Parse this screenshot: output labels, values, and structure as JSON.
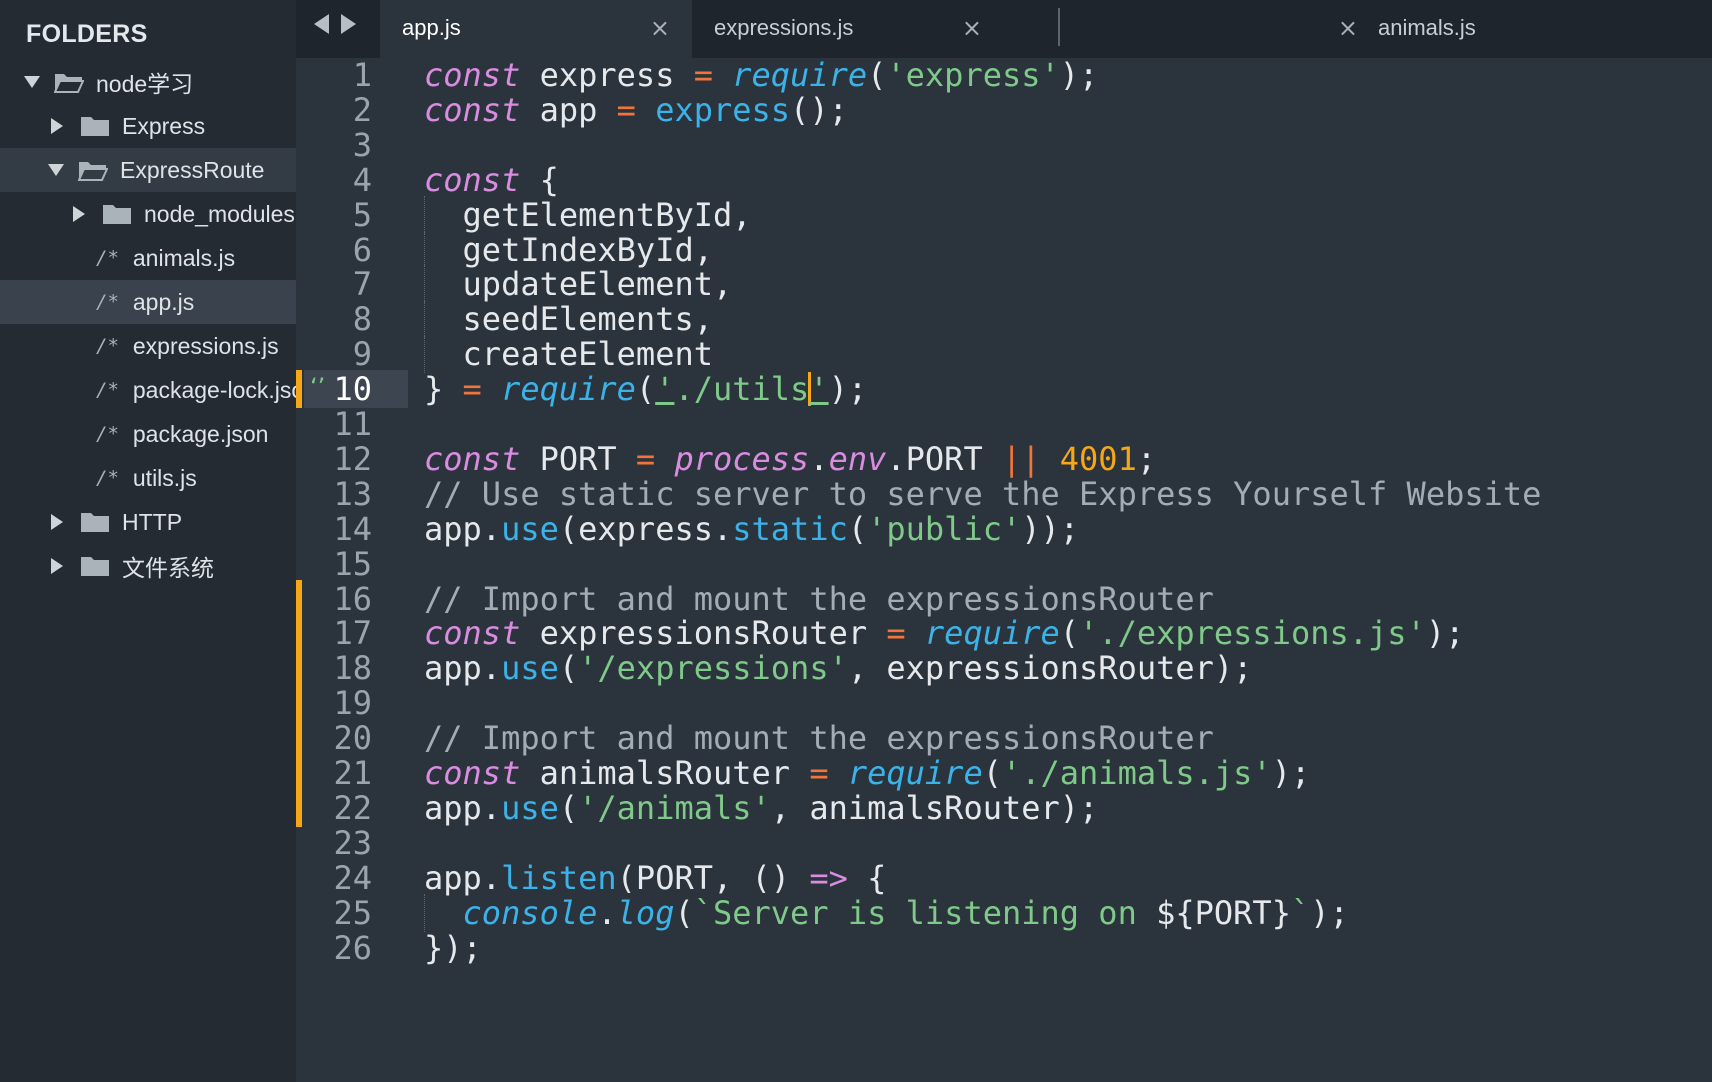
{
  "sidebar": {
    "title": "FOLDERS",
    "tree": [
      {
        "label": "node学习",
        "kind": "folder",
        "expanded": true
      },
      {
        "label": "Express",
        "kind": "folder",
        "expanded": false
      },
      {
        "label": "ExpressRoute",
        "kind": "folder",
        "expanded": true
      },
      {
        "label": "node_modules",
        "kind": "folder",
        "expanded": false
      },
      {
        "label": "animals.js",
        "kind": "file",
        "glyph": "/*"
      },
      {
        "label": "app.js",
        "kind": "file",
        "glyph": "/*"
      },
      {
        "label": "expressions.js",
        "kind": "file",
        "glyph": "/*"
      },
      {
        "label": "package-lock.json",
        "kind": "file",
        "glyph": "/*"
      },
      {
        "label": "package.json",
        "kind": "file",
        "glyph": "/*"
      },
      {
        "label": "utils.js",
        "kind": "file",
        "glyph": "/*"
      },
      {
        "label": "HTTP",
        "kind": "folder",
        "expanded": false
      },
      {
        "label": "文件系统",
        "kind": "folder",
        "expanded": false
      }
    ]
  },
  "tabs": [
    {
      "label": "app.js",
      "active": true,
      "close": "×"
    },
    {
      "label": "expressions.js",
      "active": false,
      "close": "×"
    },
    {
      "label": "animals.js",
      "active": false,
      "close": "×"
    }
  ],
  "editor": {
    "current_line": 10,
    "lint_icon_glyph": "‘’",
    "line_numbers": [
      "1",
      "2",
      "3",
      "4",
      "5",
      "6",
      "7",
      "8",
      "9",
      "10",
      "11",
      "12",
      "13",
      "14",
      "15",
      "16",
      "17",
      "18",
      "19",
      "20",
      "21",
      "22",
      "23",
      "24",
      "25",
      "26"
    ],
    "lines": [
      [
        [
          "kw",
          "const"
        ],
        [
          "pn",
          " express "
        ],
        [
          "op",
          "="
        ],
        [
          "pn",
          " "
        ],
        [
          "fi",
          "require"
        ],
        [
          "pn",
          "("
        ],
        [
          "str",
          "'express'"
        ],
        [
          "pn",
          ");"
        ]
      ],
      [
        [
          "kw",
          "const"
        ],
        [
          "pn",
          " app "
        ],
        [
          "op",
          "="
        ],
        [
          "pn",
          " "
        ],
        [
          "fn",
          "express"
        ],
        [
          "pn",
          "();"
        ]
      ],
      [],
      [
        [
          "kw",
          "const"
        ],
        [
          "pn",
          " {"
        ]
      ],
      [
        [
          "pn",
          "  getElementById,"
        ]
      ],
      [
        [
          "pn",
          "  getIndexById,"
        ]
      ],
      [
        [
          "pn",
          "  updateElement,"
        ]
      ],
      [
        [
          "pn",
          "  seedElements,"
        ]
      ],
      [
        [
          "pn",
          "  createElement"
        ]
      ],
      [
        [
          "pn",
          "} "
        ],
        [
          "op",
          "="
        ],
        [
          "pn",
          " "
        ],
        [
          "fi",
          "require"
        ],
        [
          "pn",
          "("
        ],
        [
          "str",
          "'./utils'"
        ],
        [
          "pn",
          ");"
        ]
      ],
      [],
      [
        [
          "kw",
          "const"
        ],
        [
          "pn",
          " PORT "
        ],
        [
          "op",
          "="
        ],
        [
          "pn",
          " "
        ],
        [
          "kw",
          "process"
        ],
        [
          "pn",
          "."
        ],
        [
          "kw",
          "env"
        ],
        [
          "pn",
          ".PORT "
        ],
        [
          "op",
          "||"
        ],
        [
          "pn",
          " "
        ],
        [
          "num",
          "4001"
        ],
        [
          "pn",
          ";"
        ]
      ],
      [
        [
          "cm",
          "// Use static server to serve the Express Yourself Website"
        ]
      ],
      [
        [
          "pn",
          "app."
        ],
        [
          "fn",
          "use"
        ],
        [
          "pn",
          "(express."
        ],
        [
          "fn",
          "static"
        ],
        [
          "pn",
          "("
        ],
        [
          "str",
          "'public'"
        ],
        [
          "pn",
          "));"
        ]
      ],
      [],
      [
        [
          "cm",
          "// Import and mount the expressionsRouter"
        ]
      ],
      [
        [
          "kw",
          "const"
        ],
        [
          "pn",
          " expressionsRouter "
        ],
        [
          "op",
          "="
        ],
        [
          "pn",
          " "
        ],
        [
          "fi",
          "require"
        ],
        [
          "pn",
          "("
        ],
        [
          "str",
          "'./expressions.js'"
        ],
        [
          "pn",
          ");"
        ]
      ],
      [
        [
          "pn",
          "app."
        ],
        [
          "fn",
          "use"
        ],
        [
          "pn",
          "("
        ],
        [
          "str",
          "'/expressions'"
        ],
        [
          "pn",
          ", expressionsRouter);"
        ]
      ],
      [],
      [
        [
          "cm",
          "// Import and mount the expressionsRouter"
        ]
      ],
      [
        [
          "kw",
          "const"
        ],
        [
          "pn",
          " animalsRouter "
        ],
        [
          "op",
          "="
        ],
        [
          "pn",
          " "
        ],
        [
          "fi",
          "require"
        ],
        [
          "pn",
          "("
        ],
        [
          "str",
          "'./animals.js'"
        ],
        [
          "pn",
          ");"
        ]
      ],
      [
        [
          "pn",
          "app."
        ],
        [
          "fn",
          "use"
        ],
        [
          "pn",
          "("
        ],
        [
          "str",
          "'/animals'"
        ],
        [
          "pn",
          ", animalsRouter);"
        ]
      ],
      [],
      [
        [
          "pn",
          "app."
        ],
        [
          "fn",
          "listen"
        ],
        [
          "pn",
          "(PORT, () "
        ],
        [
          "kw",
          "=>"
        ],
        [
          "pn",
          " {"
        ]
      ],
      [
        [
          "pn",
          "  "
        ],
        [
          "fi",
          "console"
        ],
        [
          "pn",
          "."
        ],
        [
          "fi",
          "log"
        ],
        [
          "pn",
          "("
        ],
        [
          "tpl",
          "`Server is listening on "
        ],
        [
          "pn",
          "${PORT}"
        ],
        [
          "tpl",
          "`"
        ],
        [
          "pn",
          ");"
        ]
      ],
      [
        [
          "pn",
          "});"
        ]
      ]
    ],
    "modified_lines": [
      10,
      16,
      17,
      18,
      19,
      20,
      21,
      22
    ],
    "indent_guide_lines": [
      5,
      6,
      7,
      8,
      9,
      25
    ]
  },
  "colors": {
    "background": "#2b333d",
    "sidebar": "#252b33",
    "keyword": "#d98ce0",
    "function": "#3cb3e8",
    "string": "#7fc989",
    "operator": "#f0753b",
    "number": "#f6a716",
    "comment": "#a3acb5",
    "modified_marker": "#f6a716"
  }
}
